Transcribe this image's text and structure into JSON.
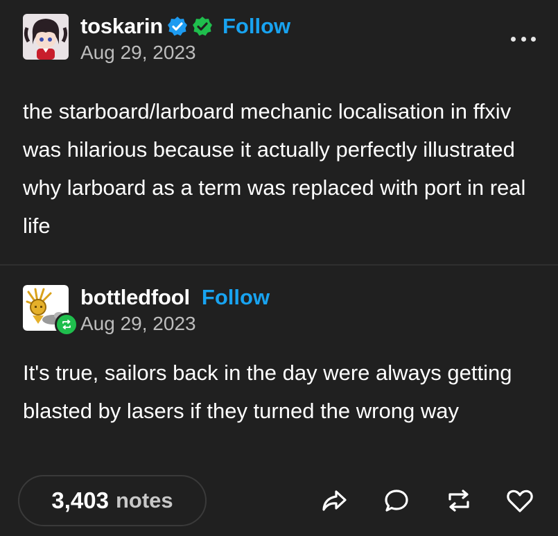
{
  "posts": [
    {
      "username": "toskarin",
      "follow_label": "Follow",
      "date": "Aug 29, 2023",
      "body": "the starboard/larboard mechanic localisation in ffxiv was hilarious because it actually perfectly illustrated why larboard as a term was replaced with port in real life"
    },
    {
      "username": "bottledfool",
      "follow_label": "Follow",
      "date": "Aug 29, 2023",
      "body": "It's true, sailors back in the day were always getting blasted by lasers if they turned the wrong way"
    }
  ],
  "footer": {
    "notes_count": "3,403",
    "notes_label": "notes",
    "actions": [
      "share-icon",
      "reply-icon",
      "reblog-icon",
      "like-icon"
    ]
  },
  "colors": {
    "background": "#202020",
    "follow_blue": "#18a3f0",
    "verified_blue": "#1d9bf0",
    "verified_green": "#1fbe4d",
    "muted_text": "#bdbdbd"
  }
}
